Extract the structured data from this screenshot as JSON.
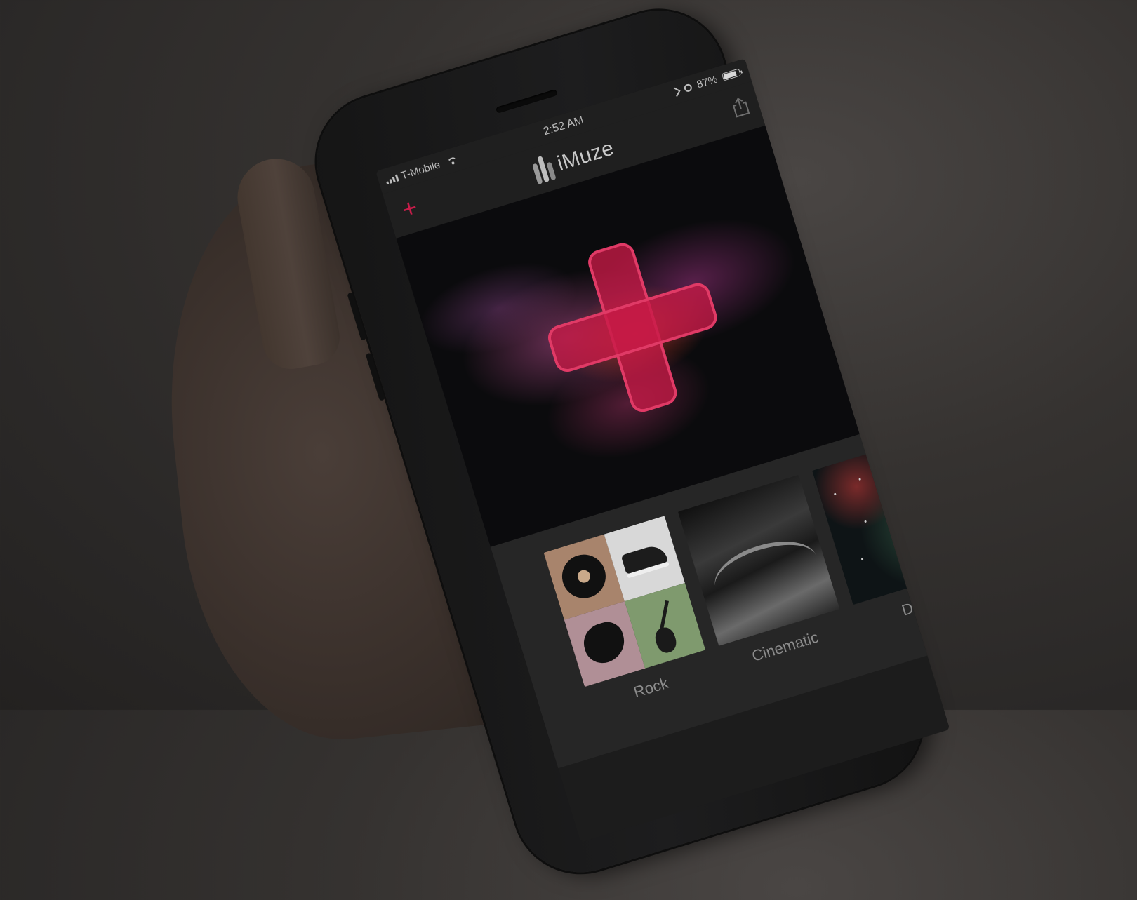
{
  "status_bar": {
    "carrier": "T-Mobile",
    "time": "2:52 AM",
    "battery": "87%",
    "battery_level": 0.87
  },
  "nav": {
    "app_name": "iMuze",
    "add_icon": "plus-icon",
    "share_icon": "share-icon"
  },
  "hero": {
    "action_icon": "plus-icon"
  },
  "genres": [
    {
      "label": "Rock"
    },
    {
      "label": "Cinematic"
    },
    {
      "label": "Dubs"
    }
  ],
  "colors": {
    "accent": "#c81d4a",
    "background": "#1c1c1c"
  }
}
